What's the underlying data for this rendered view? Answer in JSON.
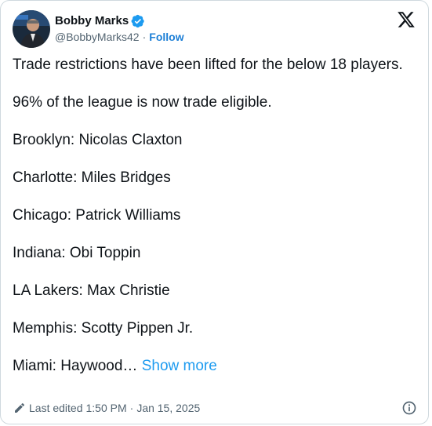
{
  "author": {
    "display_name": "Bobby Marks",
    "handle": "@BobbyMarks42",
    "separator": "·",
    "follow_label": "Follow",
    "verified": true,
    "verified_color": "#1d9bf0"
  },
  "icons": {
    "brand": "x-logo-icon",
    "verified": "verified-badge-icon",
    "edit": "pencil-edit-icon",
    "info": "info-circle-icon"
  },
  "tweet": {
    "intro": "Trade restrictions have been lifted for the below 18 players.",
    "stat": "96% of the league is now trade eligible.",
    "lines": [
      "Brooklyn: Nicolas Claxton",
      "Charlotte: Miles Bridges",
      "Chicago: Patrick Williams",
      "Indiana: Obi Toppin",
      "LA Lakers: Max Christie",
      "Memphis: Scotty Pippen Jr."
    ],
    "truncated_line": "Miami: Haywood…",
    "show_more_label": "Show more"
  },
  "footer": {
    "edited_label": "Last edited",
    "time": "1:50 PM",
    "separator": "·",
    "date": "Jan 15, 2025"
  },
  "colors": {
    "text": "#0f1419",
    "secondary": "#536471",
    "link": "#1d9bf0",
    "border": "#cfd9de"
  }
}
